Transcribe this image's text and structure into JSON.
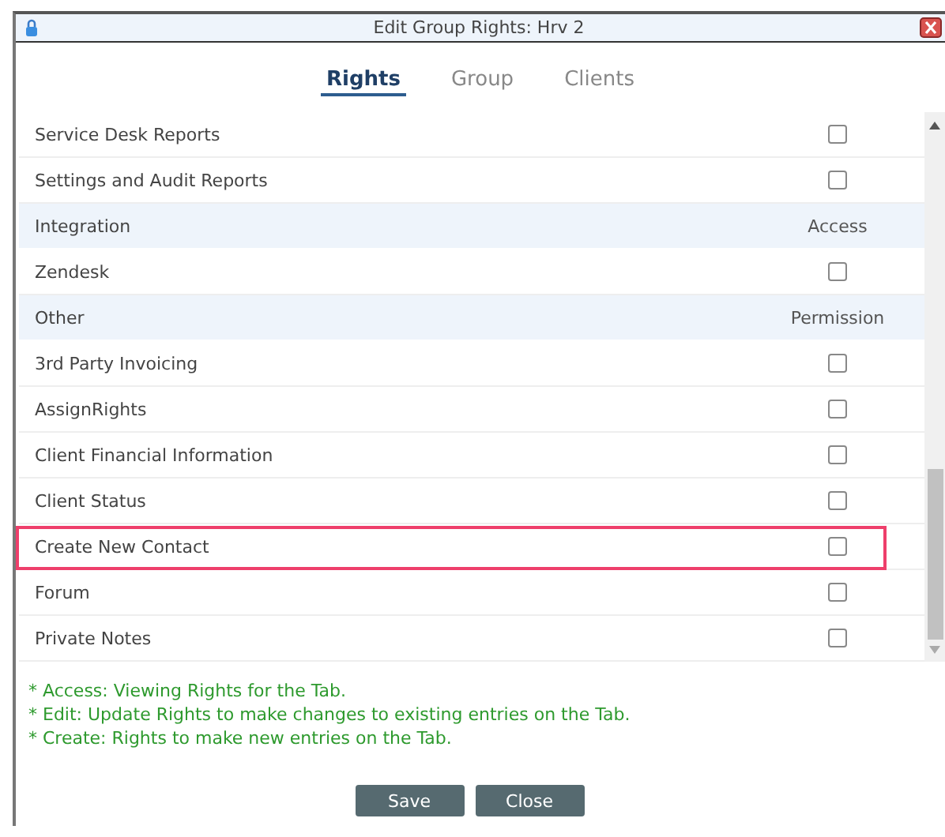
{
  "window": {
    "title": "Edit Group Rights: Hrv 2"
  },
  "tabs": [
    {
      "label": "Rights",
      "selected": true
    },
    {
      "label": "Group",
      "selected": false
    },
    {
      "label": "Clients",
      "selected": false
    }
  ],
  "rows": [
    {
      "kind": "item",
      "label": "Service Desk Reports",
      "checked": false,
      "highlighted": false
    },
    {
      "kind": "item",
      "label": "Settings and Audit Reports",
      "checked": false,
      "highlighted": false
    },
    {
      "kind": "header",
      "label": "Integration",
      "column": "Access"
    },
    {
      "kind": "item",
      "label": "Zendesk",
      "checked": false,
      "highlighted": false
    },
    {
      "kind": "header",
      "label": "Other",
      "column": "Permission"
    },
    {
      "kind": "item",
      "label": "3rd Party Invoicing",
      "checked": false,
      "highlighted": false
    },
    {
      "kind": "item",
      "label": "AssignRights",
      "checked": false,
      "highlighted": false
    },
    {
      "kind": "item",
      "label": "Client Financial Information",
      "checked": false,
      "highlighted": false
    },
    {
      "kind": "item",
      "label": "Client Status",
      "checked": false,
      "highlighted": false
    },
    {
      "kind": "item",
      "label": "Create New Contact",
      "checked": false,
      "highlighted": true
    },
    {
      "kind": "item",
      "label": "Forum",
      "checked": false,
      "highlighted": false
    },
    {
      "kind": "item",
      "label": "Private Notes",
      "checked": false,
      "highlighted": false
    }
  ],
  "notes": [
    "* Access: Viewing Rights for the Tab.",
    "* Edit: Update Rights to make changes to existing entries on the Tab.",
    "* Create: Rights to make new entries on the Tab."
  ],
  "buttons": [
    "Save",
    "Close"
  ]
}
